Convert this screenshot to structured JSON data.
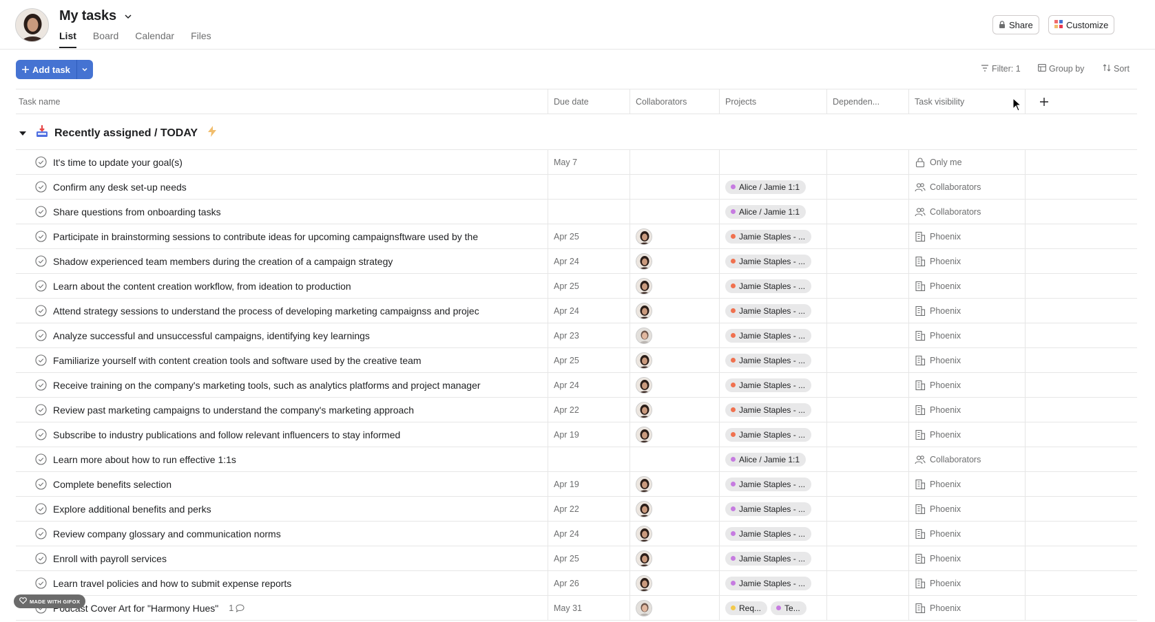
{
  "header": {
    "title": "My tasks",
    "tabs": [
      {
        "label": "List",
        "active": true
      },
      {
        "label": "Board",
        "active": false
      },
      {
        "label": "Calendar",
        "active": false
      },
      {
        "label": "Files",
        "active": false
      }
    ],
    "share_label": "Share",
    "customize_label": "Customize"
  },
  "toolbar": {
    "add_task_label": "Add task",
    "filter_label": "Filter: 1",
    "group_by_label": "Group by",
    "sort_label": "Sort"
  },
  "columns": {
    "task_name": "Task name",
    "due_date": "Due date",
    "collaborators": "Collaborators",
    "projects": "Projects",
    "dependencies": "Dependen...",
    "task_visibility": "Task visibility"
  },
  "section": {
    "title": "Recently assigned / TODAY"
  },
  "colors": {
    "accent_blue": "#4573d2",
    "dot_purple": "#c67be0",
    "dot_orange": "#f0714f",
    "dot_yellow": "#f2c94c"
  },
  "tasks": [
    {
      "name": "It's time to update your goal(s)",
      "due": "May 7",
      "collab": "",
      "projects": [],
      "visibility": "Only me",
      "vis_icon": "lock-icon"
    },
    {
      "name": "Confirm any desk set-up needs",
      "due": "",
      "collab": "",
      "projects": [
        {
          "label": "Alice / Jamie 1:1",
          "dot": "purple"
        }
      ],
      "visibility": "Collaborators",
      "vis_icon": "people-icon"
    },
    {
      "name": "Share questions from onboarding tasks",
      "due": "",
      "collab": "",
      "projects": [
        {
          "label": "Alice / Jamie 1:1",
          "dot": "purple"
        }
      ],
      "visibility": "Collaborators",
      "vis_icon": "people-icon"
    },
    {
      "name": "Participate in brainstorming sessions to contribute ideas for upcoming campaignsftware used by the",
      "due": "Apr 25",
      "collab": "a",
      "projects": [
        {
          "label": "Jamie Staples - ...",
          "dot": "orange"
        }
      ],
      "visibility": "Phoenix",
      "vis_icon": "building-icon"
    },
    {
      "name": "Shadow experienced team members during the creation of a campaign strategy",
      "due": "Apr 24",
      "collab": "a",
      "projects": [
        {
          "label": "Jamie Staples - ...",
          "dot": "orange"
        }
      ],
      "visibility": "Phoenix",
      "vis_icon": "building-icon"
    },
    {
      "name": "Learn about the content creation workflow, from ideation to production",
      "due": "Apr 25",
      "collab": "a",
      "projects": [
        {
          "label": "Jamie Staples - ...",
          "dot": "orange"
        }
      ],
      "visibility": "Phoenix",
      "vis_icon": "building-icon"
    },
    {
      "name": "Attend strategy sessions to understand the process of developing marketing campaignss and projec",
      "due": "Apr 24",
      "collab": "a",
      "projects": [
        {
          "label": "Jamie Staples - ...",
          "dot": "orange"
        }
      ],
      "visibility": "Phoenix",
      "vis_icon": "building-icon"
    },
    {
      "name": "Analyze successful and unsuccessful campaigns, identifying key learnings",
      "due": "Apr 23",
      "collab": "b",
      "projects": [
        {
          "label": "Jamie Staples - ...",
          "dot": "orange"
        }
      ],
      "visibility": "Phoenix",
      "vis_icon": "building-icon"
    },
    {
      "name": "Familiarize yourself with content creation tools and software used by the creative team",
      "due": "Apr 25",
      "collab": "a",
      "projects": [
        {
          "label": "Jamie Staples - ...",
          "dot": "orange"
        }
      ],
      "visibility": "Phoenix",
      "vis_icon": "building-icon"
    },
    {
      "name": "Receive training on the company's marketing tools, such as analytics platforms and project manager",
      "due": "Apr 24",
      "collab": "a",
      "projects": [
        {
          "label": "Jamie Staples - ...",
          "dot": "orange"
        }
      ],
      "visibility": "Phoenix",
      "vis_icon": "building-icon"
    },
    {
      "name": "Review past marketing campaigns to understand the company's marketing approach",
      "due": "Apr 22",
      "collab": "a",
      "projects": [
        {
          "label": "Jamie Staples - ...",
          "dot": "orange"
        }
      ],
      "visibility": "Phoenix",
      "vis_icon": "building-icon"
    },
    {
      "name": "Subscribe to industry publications and follow relevant influencers to stay informed",
      "due": "Apr 19",
      "collab": "a",
      "projects": [
        {
          "label": "Jamie Staples - ...",
          "dot": "orange"
        }
      ],
      "visibility": "Phoenix",
      "vis_icon": "building-icon"
    },
    {
      "name": "Learn more about how to run effective 1:1s",
      "due": "",
      "collab": "",
      "projects": [
        {
          "label": "Alice / Jamie 1:1",
          "dot": "purple"
        }
      ],
      "visibility": "Collaborators",
      "vis_icon": "people-icon"
    },
    {
      "name": "Complete benefits selection",
      "due": "Apr 19",
      "collab": "a",
      "projects": [
        {
          "label": "Jamie Staples - ...",
          "dot": "purple"
        }
      ],
      "visibility": "Phoenix",
      "vis_icon": "building-icon"
    },
    {
      "name": "Explore additional benefits and perks",
      "due": "Apr 22",
      "collab": "a",
      "projects": [
        {
          "label": "Jamie Staples - ...",
          "dot": "purple"
        }
      ],
      "visibility": "Phoenix",
      "vis_icon": "building-icon"
    },
    {
      "name": "Review company glossary and communication norms",
      "due": "Apr 24",
      "collab": "a",
      "projects": [
        {
          "label": "Jamie Staples - ...",
          "dot": "purple"
        }
      ],
      "visibility": "Phoenix",
      "vis_icon": "building-icon"
    },
    {
      "name": "Enroll with payroll services",
      "due": "Apr 25",
      "collab": "a",
      "projects": [
        {
          "label": "Jamie Staples - ...",
          "dot": "purple"
        }
      ],
      "visibility": "Phoenix",
      "vis_icon": "building-icon"
    },
    {
      "name": "Learn travel policies and how to submit expense reports",
      "due": "Apr 26",
      "collab": "a",
      "projects": [
        {
          "label": "Jamie Staples - ...",
          "dot": "purple"
        }
      ],
      "visibility": "Phoenix",
      "vis_icon": "building-icon"
    },
    {
      "name": "Podcast Cover Art for \"Harmony Hues\"",
      "due": "May 31",
      "collab": "b",
      "comment_count": "1",
      "projects": [
        {
          "label": "Req...",
          "dot": "yellow"
        },
        {
          "label": "Te...",
          "dot": "purple"
        }
      ],
      "visibility": "Phoenix",
      "vis_icon": "building-icon"
    }
  ],
  "watermark": "MADE WITH GIFOX"
}
